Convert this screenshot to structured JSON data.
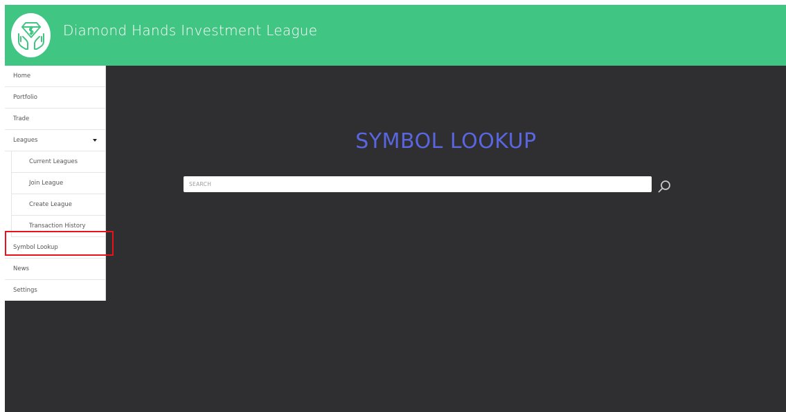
{
  "header": {
    "title": "Diamond Hands Investment League",
    "logo_icon": "money-hands-icon",
    "background": "#41c583"
  },
  "sidebar": {
    "items": [
      {
        "label": "Home"
      },
      {
        "label": "Portfolio"
      },
      {
        "label": "Trade"
      },
      {
        "label": "Leagues",
        "expanded": true,
        "icon": "caret-down-icon",
        "children": [
          {
            "label": "Current Leagues"
          },
          {
            "label": "Join League"
          },
          {
            "label": "Create League"
          },
          {
            "label": "Transaction History"
          }
        ]
      },
      {
        "label": "Symbol Lookup",
        "highlighted": true
      },
      {
        "label": "News"
      },
      {
        "label": "Settings"
      }
    ],
    "highlight_color": "#e8121b"
  },
  "main": {
    "title": "SYMBOL LOOKUP",
    "title_color": "#5a66e0",
    "background": "#2f2f31",
    "search": {
      "placeholder": "SEARCH",
      "value": "",
      "button_icon": "magnifier-icon"
    }
  }
}
